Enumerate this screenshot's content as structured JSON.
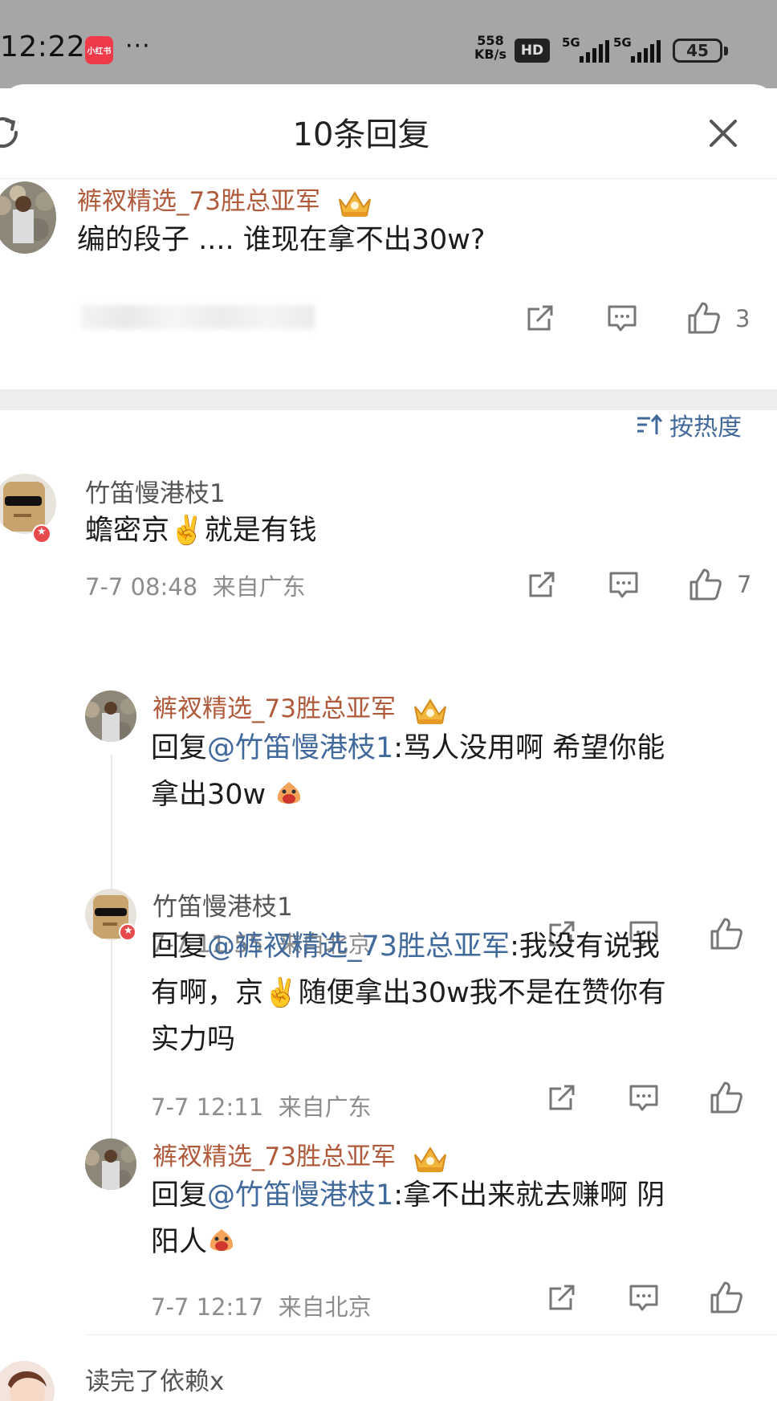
{
  "status_bar": {
    "time": "12:22",
    "app_badge": "小红书",
    "more": "···",
    "speed_value": "558",
    "speed_unit": "KB/s",
    "hd": "HD",
    "net1": "5G",
    "net2": "5G",
    "battery": "45"
  },
  "sheet": {
    "title": "10条回复"
  },
  "root_comment": {
    "author": "裤衩精选_73胜总亚军",
    "text": "编的段子 .... 谁现在拿不出30w?",
    "likes": "3"
  },
  "sort": {
    "label": "按热度"
  },
  "comments": [
    {
      "author": "竹笛慢港枝1",
      "text": "蟾密京✌️就是有钱",
      "time": "7-7 08:48",
      "location": "来自广东",
      "likes": "7"
    }
  ],
  "replies": [
    {
      "author": "裤衩精选_73胜总亚军",
      "prefix": "回复",
      "mention": "@竹笛慢港枝1",
      "body_line1": ":骂人没用啊 希望你能",
      "body_line2": "拿出30w",
      "time": "7-7 11:55",
      "location": "来自北京"
    },
    {
      "author": "竹笛慢港枝1",
      "prefix": "回复",
      "mention": "@裤衩精选_73胜总亚军",
      "body_line1": ":我没有说我",
      "body_line2": "有啊，京✌️随便拿出30w我不是在赞你有",
      "body_line3": "实力吗",
      "time": "7-7 12:11",
      "location": "来自广东"
    },
    {
      "author": "裤衩精选_73胜总亚军",
      "prefix": "回复",
      "mention": "@竹笛慢港枝1",
      "body_line1": ":拿不出来就去赚啊 阴",
      "body_line2": "阳人",
      "time": "7-7 12:17",
      "location": "来自北京"
    }
  ],
  "next_comment": {
    "author": "读完了依赖x"
  },
  "colors": {
    "author_highlight": "#b05a3c",
    "mention": "#41699c",
    "meta": "#8c8c8c",
    "status_bar_bg": "#a6a6a6"
  },
  "icons": [
    "refresh-icon",
    "close-icon",
    "crown-badge-icon",
    "share-icon",
    "comment-icon",
    "like-icon",
    "sort-icon",
    "emoji-icon"
  ]
}
